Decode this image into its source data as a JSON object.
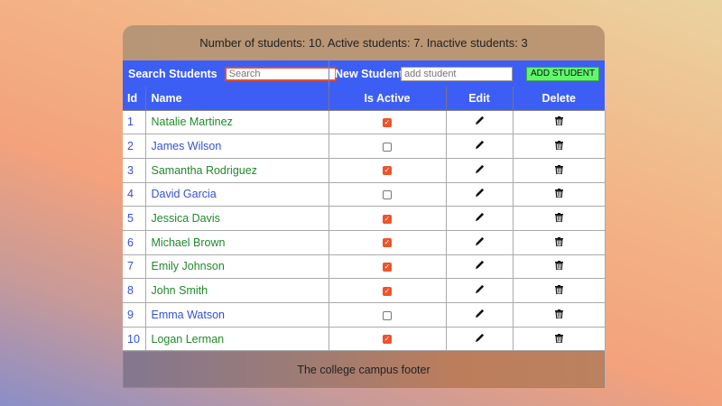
{
  "summary": "Number of students: 10. Active students: 7. Inactive students: 3",
  "toolbar": {
    "search_label": "Search Students",
    "search_placeholder": "Search",
    "search_value": "",
    "new_label": "New Student",
    "new_placeholder": "add student",
    "add_button": "ADD STUDENT"
  },
  "columns": [
    "Id",
    "Name",
    "Is Active",
    "Edit",
    "Delete"
  ],
  "icons": {
    "edit": "pencil-icon",
    "delete": "trash-icon"
  },
  "colors": {
    "header": "#3d5ef5",
    "active_name": "#1f8a2a",
    "inactive_name": "#3450d8",
    "checkbox": "#f0522a",
    "add_button": "#5ff86a"
  },
  "students": [
    {
      "id": "1",
      "name": "Natalie Martinez",
      "active": true
    },
    {
      "id": "2",
      "name": "James Wilson",
      "active": false
    },
    {
      "id": "3",
      "name": "Samantha Rodriguez",
      "active": true
    },
    {
      "id": "4",
      "name": "David Garcia",
      "active": false
    },
    {
      "id": "5",
      "name": "Jessica Davis",
      "active": true
    },
    {
      "id": "6",
      "name": "Michael Brown",
      "active": true
    },
    {
      "id": "7",
      "name": "Emily Johnson",
      "active": true
    },
    {
      "id": "8",
      "name": "John Smith",
      "active": true
    },
    {
      "id": "9",
      "name": "Emma Watson",
      "active": false
    },
    {
      "id": "10",
      "name": "Logan Lerman",
      "active": true
    }
  ],
  "footer": "The college campus footer"
}
